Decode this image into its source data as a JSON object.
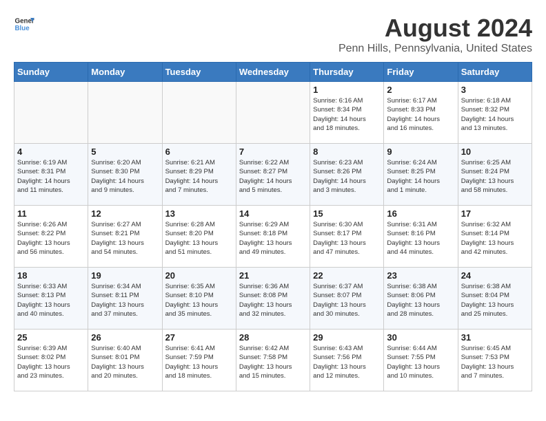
{
  "header": {
    "logo_line1": "General",
    "logo_line2": "Blue",
    "title": "August 2024",
    "subtitle": "Penn Hills, Pennsylvania, United States"
  },
  "weekdays": [
    "Sunday",
    "Monday",
    "Tuesday",
    "Wednesday",
    "Thursday",
    "Friday",
    "Saturday"
  ],
  "weeks": [
    [
      {
        "day": "",
        "info": "",
        "empty": true
      },
      {
        "day": "",
        "info": "",
        "empty": true
      },
      {
        "day": "",
        "info": "",
        "empty": true
      },
      {
        "day": "",
        "info": "",
        "empty": true
      },
      {
        "day": "1",
        "info": "Sunrise: 6:16 AM\nSunset: 8:34 PM\nDaylight: 14 hours\nand 18 minutes."
      },
      {
        "day": "2",
        "info": "Sunrise: 6:17 AM\nSunset: 8:33 PM\nDaylight: 14 hours\nand 16 minutes."
      },
      {
        "day": "3",
        "info": "Sunrise: 6:18 AM\nSunset: 8:32 PM\nDaylight: 14 hours\nand 13 minutes."
      }
    ],
    [
      {
        "day": "4",
        "info": "Sunrise: 6:19 AM\nSunset: 8:31 PM\nDaylight: 14 hours\nand 11 minutes."
      },
      {
        "day": "5",
        "info": "Sunrise: 6:20 AM\nSunset: 8:30 PM\nDaylight: 14 hours\nand 9 minutes."
      },
      {
        "day": "6",
        "info": "Sunrise: 6:21 AM\nSunset: 8:29 PM\nDaylight: 14 hours\nand 7 minutes."
      },
      {
        "day": "7",
        "info": "Sunrise: 6:22 AM\nSunset: 8:27 PM\nDaylight: 14 hours\nand 5 minutes."
      },
      {
        "day": "8",
        "info": "Sunrise: 6:23 AM\nSunset: 8:26 PM\nDaylight: 14 hours\nand 3 minutes."
      },
      {
        "day": "9",
        "info": "Sunrise: 6:24 AM\nSunset: 8:25 PM\nDaylight: 14 hours\nand 1 minute."
      },
      {
        "day": "10",
        "info": "Sunrise: 6:25 AM\nSunset: 8:24 PM\nDaylight: 13 hours\nand 58 minutes."
      }
    ],
    [
      {
        "day": "11",
        "info": "Sunrise: 6:26 AM\nSunset: 8:22 PM\nDaylight: 13 hours\nand 56 minutes."
      },
      {
        "day": "12",
        "info": "Sunrise: 6:27 AM\nSunset: 8:21 PM\nDaylight: 13 hours\nand 54 minutes."
      },
      {
        "day": "13",
        "info": "Sunrise: 6:28 AM\nSunset: 8:20 PM\nDaylight: 13 hours\nand 51 minutes."
      },
      {
        "day": "14",
        "info": "Sunrise: 6:29 AM\nSunset: 8:18 PM\nDaylight: 13 hours\nand 49 minutes."
      },
      {
        "day": "15",
        "info": "Sunrise: 6:30 AM\nSunset: 8:17 PM\nDaylight: 13 hours\nand 47 minutes."
      },
      {
        "day": "16",
        "info": "Sunrise: 6:31 AM\nSunset: 8:16 PM\nDaylight: 13 hours\nand 44 minutes."
      },
      {
        "day": "17",
        "info": "Sunrise: 6:32 AM\nSunset: 8:14 PM\nDaylight: 13 hours\nand 42 minutes."
      }
    ],
    [
      {
        "day": "18",
        "info": "Sunrise: 6:33 AM\nSunset: 8:13 PM\nDaylight: 13 hours\nand 40 minutes."
      },
      {
        "day": "19",
        "info": "Sunrise: 6:34 AM\nSunset: 8:11 PM\nDaylight: 13 hours\nand 37 minutes."
      },
      {
        "day": "20",
        "info": "Sunrise: 6:35 AM\nSunset: 8:10 PM\nDaylight: 13 hours\nand 35 minutes."
      },
      {
        "day": "21",
        "info": "Sunrise: 6:36 AM\nSunset: 8:08 PM\nDaylight: 13 hours\nand 32 minutes."
      },
      {
        "day": "22",
        "info": "Sunrise: 6:37 AM\nSunset: 8:07 PM\nDaylight: 13 hours\nand 30 minutes."
      },
      {
        "day": "23",
        "info": "Sunrise: 6:38 AM\nSunset: 8:06 PM\nDaylight: 13 hours\nand 28 minutes."
      },
      {
        "day": "24",
        "info": "Sunrise: 6:38 AM\nSunset: 8:04 PM\nDaylight: 13 hours\nand 25 minutes."
      }
    ],
    [
      {
        "day": "25",
        "info": "Sunrise: 6:39 AM\nSunset: 8:02 PM\nDaylight: 13 hours\nand 23 minutes."
      },
      {
        "day": "26",
        "info": "Sunrise: 6:40 AM\nSunset: 8:01 PM\nDaylight: 13 hours\nand 20 minutes."
      },
      {
        "day": "27",
        "info": "Sunrise: 6:41 AM\nSunset: 7:59 PM\nDaylight: 13 hours\nand 18 minutes."
      },
      {
        "day": "28",
        "info": "Sunrise: 6:42 AM\nSunset: 7:58 PM\nDaylight: 13 hours\nand 15 minutes."
      },
      {
        "day": "29",
        "info": "Sunrise: 6:43 AM\nSunset: 7:56 PM\nDaylight: 13 hours\nand 12 minutes."
      },
      {
        "day": "30",
        "info": "Sunrise: 6:44 AM\nSunset: 7:55 PM\nDaylight: 13 hours\nand 10 minutes."
      },
      {
        "day": "31",
        "info": "Sunrise: 6:45 AM\nSunset: 7:53 PM\nDaylight: 13 hours\nand 7 minutes."
      }
    ]
  ]
}
